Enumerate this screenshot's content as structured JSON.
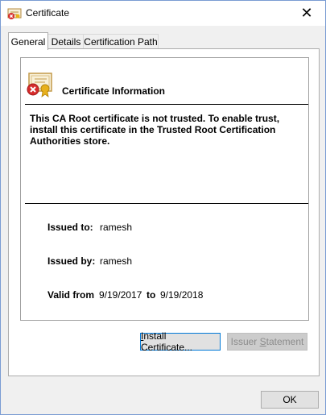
{
  "window": {
    "title": "Certificate"
  },
  "tabs": [
    {
      "label": "General"
    },
    {
      "label": "Details"
    },
    {
      "label": "Certification Path"
    }
  ],
  "info": {
    "title": "Certificate Information",
    "warning": "This CA Root certificate is not trusted. To enable trust, install this certificate in the Trusted Root Certification Authorities store."
  },
  "fields": {
    "issued_to_label": "Issued to:",
    "issued_to_value": "ramesh",
    "issued_by_label": "Issued by:",
    "issued_by_value": "ramesh",
    "valid_from_label": "Valid from",
    "valid_from_value": "9/19/2017",
    "to_label": "to",
    "valid_to_value": "9/19/2018"
  },
  "buttons": {
    "install_pre": "",
    "install_u": "I",
    "install_post": "nstall Certificate...",
    "issuer_pre": "Issuer ",
    "issuer_u": "S",
    "issuer_post": "tatement",
    "ok": "OK"
  },
  "colors": {
    "accent": "#0078d7",
    "disabled_text": "#8c8c8c"
  }
}
